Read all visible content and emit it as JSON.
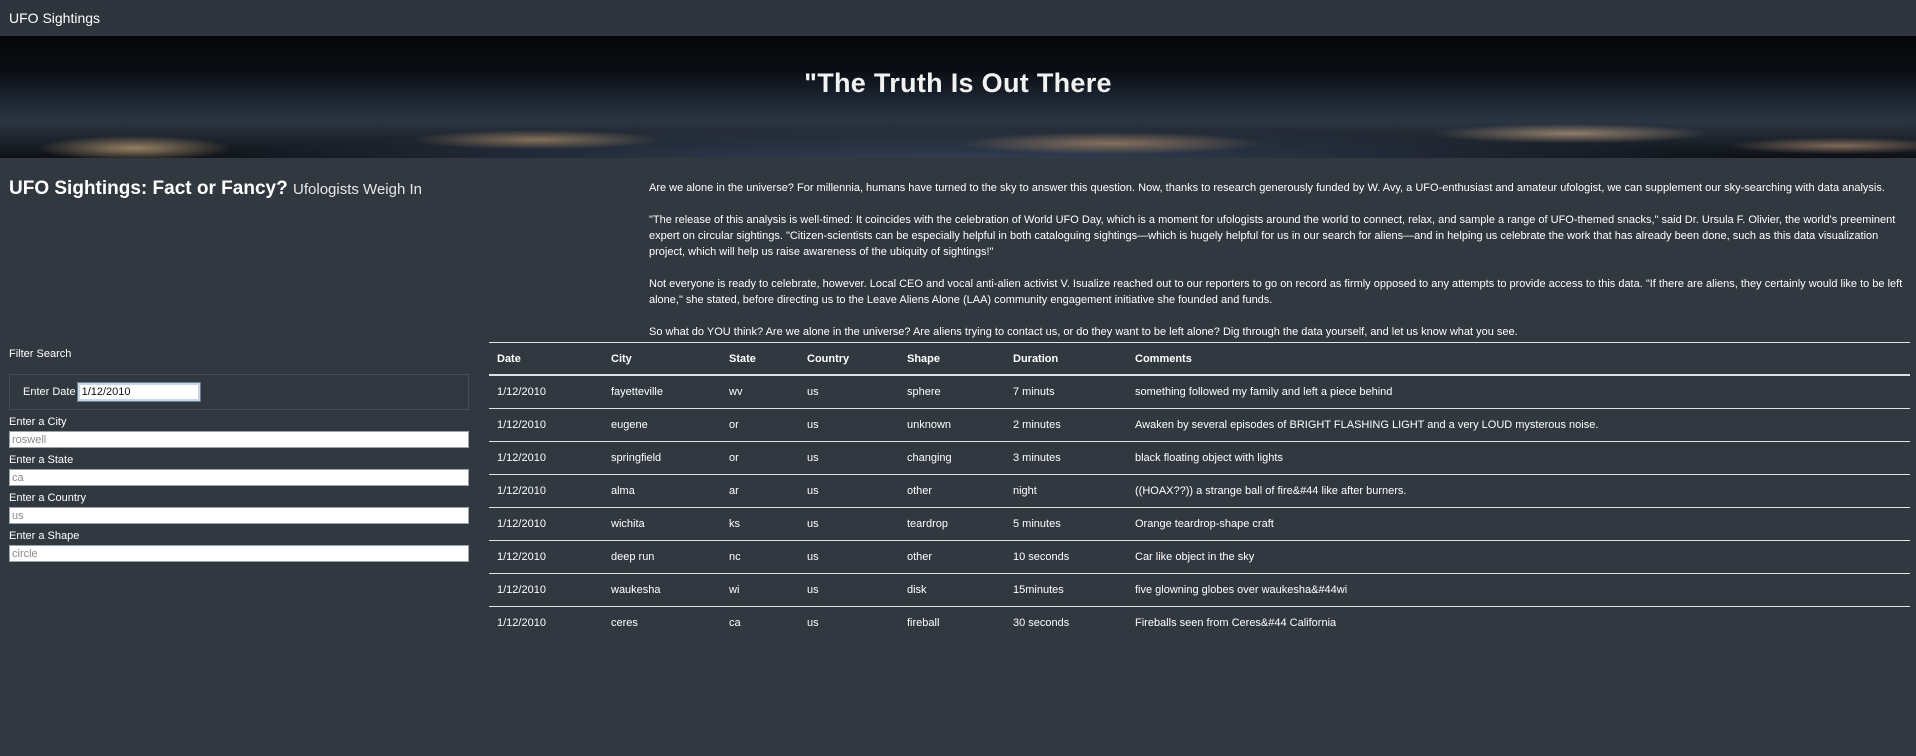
{
  "nav": {
    "brand": "UFO Sightings"
  },
  "hero": {
    "title": "\"The Truth Is Out There"
  },
  "intro": {
    "headline": "UFO Sightings: Fact or Fancy?",
    "subheadline": "Ufologists Weigh In",
    "paragraphs": [
      "Are we alone in the universe? For millennia, humans have turned to the sky to answer this question. Now, thanks to research generously funded by W. Avy, a UFO-enthusiast and amateur ufologist, we can supplement our sky-searching with data analysis.",
      "\"The release of this analysis is well-timed: It coincides with the celebration of World UFO Day, which is a moment for ufologists around the world to connect, relax, and sample a range of UFO-themed snacks,\" said Dr. Ursula F. Olivier, the world's preeminent expert on circular sightings. \"Citizen-scientists can be especially helpful in both cataloguing sightings—which is hugely helpful for us in our search for aliens—and in helping us celebrate the work that has already been done, such as this data visualization project, which will help us raise awareness of the ubiquity of sightings!\"",
      "Not everyone is ready to celebrate, however. Local CEO and vocal anti-alien activist V. Isualize reached out to our reporters to go on record as firmly opposed to any attempts to provide access to this data. \"If there are aliens, they certainly would like to be left alone,\" she stated, before directing us to the Leave Aliens Alone (LAA) community engagement initiative she founded and funds.",
      "So what do YOU think? Are we alone in the universe? Are aliens trying to contact us, or do they want to be left alone? Dig through the data yourself, and let us know what you see."
    ]
  },
  "filters": {
    "title": "Filter Search",
    "date_label": "Enter Date",
    "date_value": "1/12/2010",
    "city_label": "Enter a City",
    "city_placeholder": "roswell",
    "state_label": "Enter a State",
    "state_placeholder": "ca",
    "country_label": "Enter a Country",
    "country_placeholder": "us",
    "shape_label": "Enter a Shape",
    "shape_placeholder": "circle"
  },
  "table": {
    "headers": [
      "Date",
      "City",
      "State",
      "Country",
      "Shape",
      "Duration",
      "Comments"
    ],
    "rows": [
      [
        "1/12/2010",
        "fayetteville",
        "wv",
        "us",
        "sphere",
        "7 minuts",
        "something followed my family and left a piece behind"
      ],
      [
        "1/12/2010",
        "eugene",
        "or",
        "us",
        "unknown",
        "2 minutes",
        "Awaken by several episodes of BRIGHT FLASHING LIGHT and a very LOUD mysterous noise."
      ],
      [
        "1/12/2010",
        "springfield",
        "or",
        "us",
        "changing",
        "3 minutes",
        "black floating object with lights"
      ],
      [
        "1/12/2010",
        "alma",
        "ar",
        "us",
        "other",
        "night",
        "((HOAX??)) a strange ball of fire&#44 like after burners."
      ],
      [
        "1/12/2010",
        "wichita",
        "ks",
        "us",
        "teardrop",
        "5 minutes",
        "Orange teardrop-shape craft"
      ],
      [
        "1/12/2010",
        "deep run",
        "nc",
        "us",
        "other",
        "10 seconds",
        "Car like object in the sky"
      ],
      [
        "1/12/2010",
        "waukesha",
        "wi",
        "us",
        "disk",
        "15minutes",
        "five glowning globes over waukesha&#44wi"
      ],
      [
        "1/12/2010",
        "ceres",
        "ca",
        "us",
        "fireball",
        "30 seconds",
        "Fireballs seen from Ceres&#44 California"
      ]
    ]
  }
}
